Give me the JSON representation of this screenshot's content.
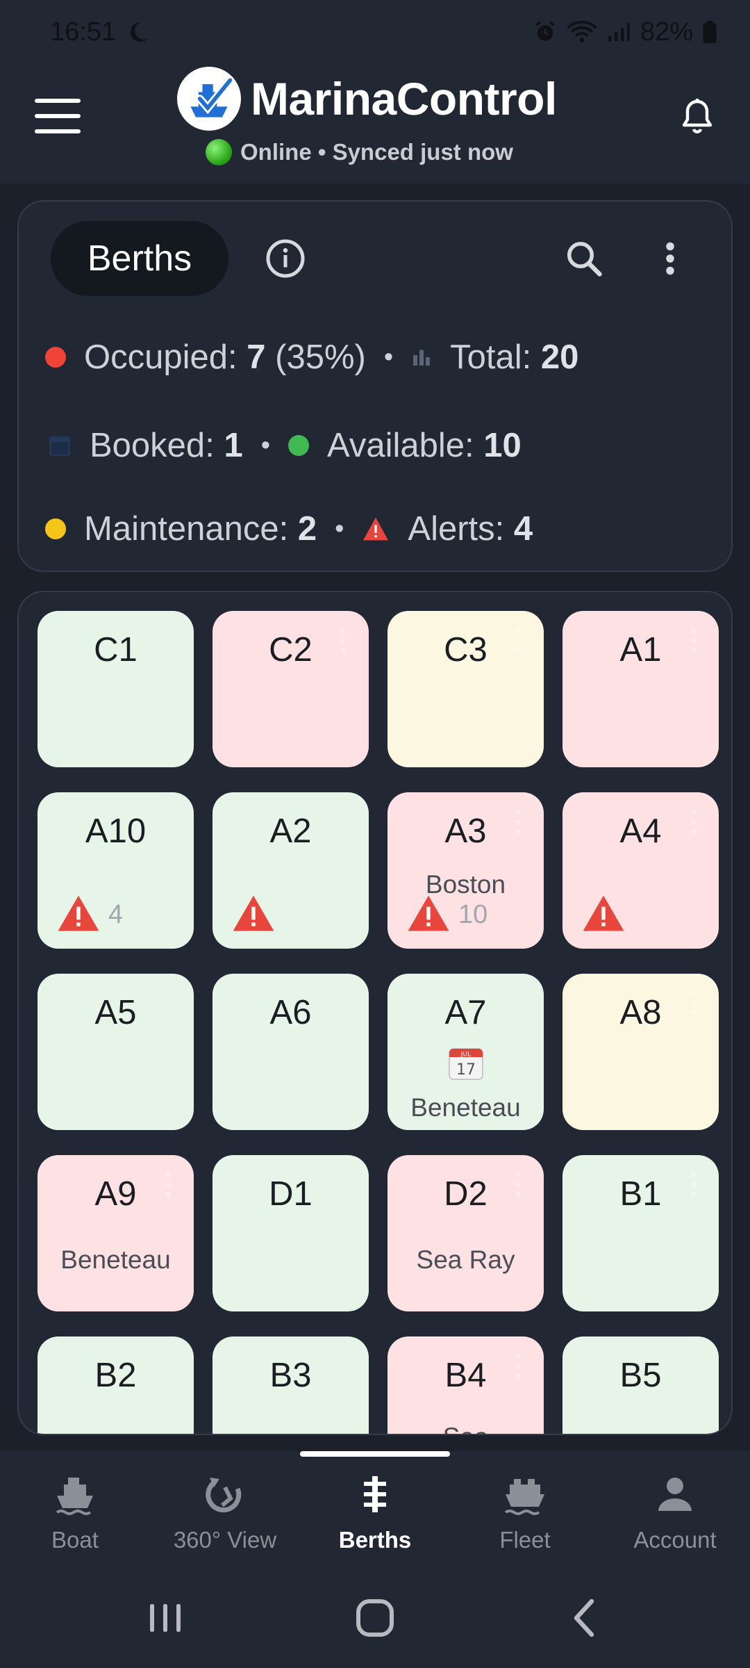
{
  "status_bar": {
    "time": "16:51",
    "battery": "82%"
  },
  "header": {
    "title": "MarinaControl",
    "sync_status": "Online • Synced just now"
  },
  "summary": {
    "tab_label": "Berths",
    "occupied_label": "Occupied:",
    "occupied_value": "7",
    "occupied_pct": "(35%)",
    "total_label": "Total:",
    "total_value": "20",
    "booked_label": "Booked:",
    "booked_value": "1",
    "available_label": "Available:",
    "available_value": "10",
    "maintenance_label": "Maintenance:",
    "maintenance_value": "2",
    "alerts_label": "Alerts:",
    "alerts_value": "4",
    "separator": "•"
  },
  "colors": {
    "occupied": "#f04438",
    "available": "#3fb950",
    "maintenance": "#f5c518",
    "alert": "#e8453c",
    "tile_free": "#e7f4e8",
    "tile_occupied": "#fde1e3",
    "tile_maintenance": "#fcf7e1"
  },
  "berths": [
    {
      "name": "C1",
      "status": "free"
    },
    {
      "name": "C2",
      "status": "occ",
      "menu": true
    },
    {
      "name": "C3",
      "status": "maint",
      "menu": true
    },
    {
      "name": "A1",
      "status": "occ",
      "menu": true
    },
    {
      "name": "A10",
      "status": "free",
      "alert": true,
      "alert_count": "4"
    },
    {
      "name": "A2",
      "status": "free",
      "alert": true
    },
    {
      "name": "A3",
      "status": "occ",
      "menu": true,
      "boat": "Boston",
      "alert": true,
      "alert_count": "10"
    },
    {
      "name": "A4",
      "status": "occ",
      "menu": true,
      "alert": true
    },
    {
      "name": "A5",
      "status": "free"
    },
    {
      "name": "A6",
      "status": "free"
    },
    {
      "name": "A7",
      "status": "free",
      "booked": true,
      "calendar_month": "JUL",
      "calendar_day": "17",
      "boat": "Beneteau"
    },
    {
      "name": "A8",
      "status": "maint",
      "menu": true
    },
    {
      "name": "A9",
      "status": "occ",
      "menu": true,
      "boat": "Beneteau"
    },
    {
      "name": "D1",
      "status": "free"
    },
    {
      "name": "D2",
      "status": "occ",
      "menu": true,
      "boat": "Sea Ray"
    },
    {
      "name": "B1",
      "status": "free",
      "menu": true
    },
    {
      "name": "B2",
      "status": "free"
    },
    {
      "name": "B3",
      "status": "free"
    },
    {
      "name": "B4",
      "status": "occ",
      "menu": true,
      "boat": "Sea"
    },
    {
      "name": "B5",
      "status": "free"
    }
  ],
  "nav": [
    {
      "id": "boat",
      "label": "Boat",
      "icon": "ship-icon"
    },
    {
      "id": "view360",
      "label": "360° View",
      "icon": "rotate-360-icon"
    },
    {
      "id": "berths",
      "label": "Berths",
      "icon": "berths-icon",
      "active": true
    },
    {
      "id": "fleet",
      "label": "Fleet",
      "icon": "fleet-icon"
    },
    {
      "id": "account",
      "label": "Account",
      "icon": "person-icon"
    }
  ]
}
